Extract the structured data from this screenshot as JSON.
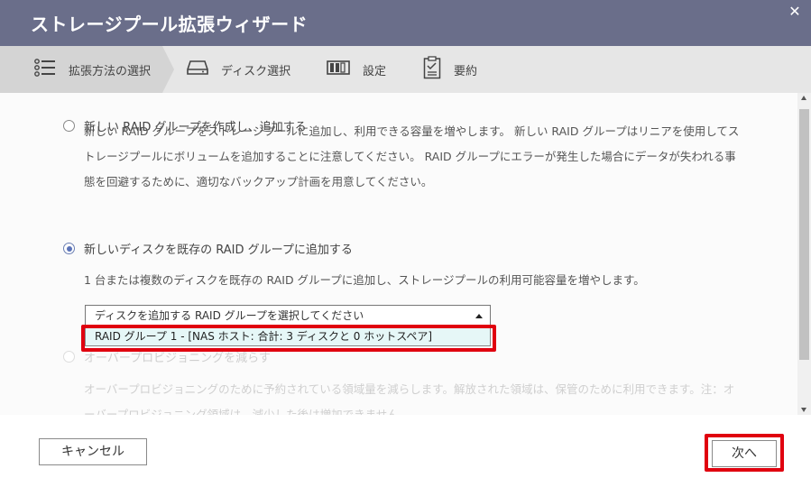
{
  "window": {
    "title": "ストレージプール拡張ウィザード",
    "close_glyph": "✕"
  },
  "steps": [
    {
      "label": "拡張方法の選択",
      "icon": "list-icon",
      "active": true
    },
    {
      "label": "ディスク選択",
      "icon": "drive-icon",
      "active": false
    },
    {
      "label": "設定",
      "icon": "storage-icon",
      "active": false
    },
    {
      "label": "要約",
      "icon": "clipboard-icon",
      "active": false
    }
  ],
  "options": {
    "create_new": {
      "label": "新しい RAID グループを作成し、追加する",
      "selected": false,
      "description": "新しい RAID グループをストレージプールに追加し、利用できる容量を増やします。 新しい RAID グループはリニアを使用してストレージプールにボリュームを追加することに注意してください。 RAID グループにエラーが発生した場合にデータが失われる事態を回避するために、適切なバックアップ計画を用意してください。"
    },
    "add_existing": {
      "label": "新しいディスクを既存の RAID グループに追加する",
      "selected": true,
      "description": "1 台または複数のディスクを既存の RAID グループに追加し、ストレージプールの利用可能容量を増やします。"
    },
    "reduce_overprov": {
      "label": "オーバープロビジョニングを減らす",
      "selected": false,
      "enabled": false,
      "description": "オーバープロビジョニングのために予約されている領域量を減らします。解放された領域は、保管のために利用できます。注：オーバープロビジョニング領域は、減少した後は増加できません。"
    }
  },
  "raid_select": {
    "placeholder": "ディスクを追加する RAID グループを選択してください",
    "options": [
      "RAID グループ 1 - [NAS ホスト: 合計: 3 ディスクと 0 ホットスペア]"
    ]
  },
  "buttons": {
    "cancel": "キャンセル",
    "next": "次へ"
  },
  "colors": {
    "titlebar": "#6a6e8a",
    "highlight": "#e0000f",
    "dropdown_option_bg": "#e6f7f7"
  }
}
